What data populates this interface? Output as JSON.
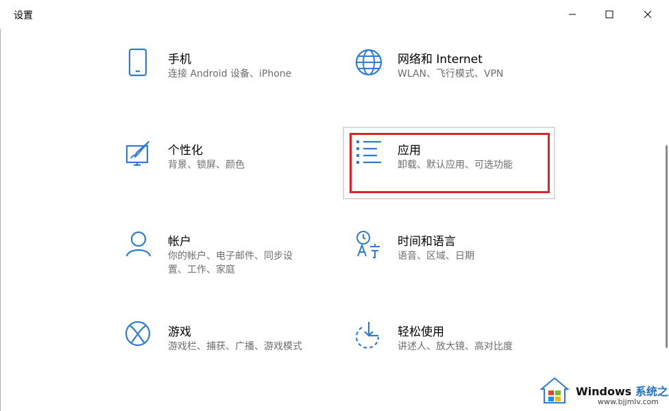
{
  "window": {
    "title": "设置",
    "controls": [
      "minimize",
      "maximize",
      "close"
    ]
  },
  "accent_color": "#2b7bd6",
  "highlight_color": "#e02027",
  "categories": [
    {
      "id": "phone",
      "icon": "phone-icon",
      "title": "手机",
      "desc": [
        "连接 Android 设备、iPhone"
      ]
    },
    {
      "id": "network",
      "icon": "globe-icon",
      "title": "网络和 Internet",
      "desc": [
        "WLAN、飞行模式、VPN"
      ]
    },
    {
      "id": "personalization",
      "icon": "paint-icon",
      "title": "个性化",
      "desc": [
        "背景、锁屏、颜色"
      ]
    },
    {
      "id": "apps",
      "icon": "apps-list-icon",
      "title": "应用",
      "desc": [
        "卸载、默认应用、可选功能"
      ],
      "highlighted": true
    },
    {
      "id": "accounts",
      "icon": "person-icon",
      "title": "帐户",
      "desc": [
        "你的帐户、电子邮件、同步设",
        "置、工作、家庭"
      ]
    },
    {
      "id": "time-language",
      "icon": "time-language-icon",
      "title": "时间和语言",
      "desc": [
        "语音、区域、日期"
      ]
    },
    {
      "id": "gaming",
      "icon": "xbox-icon",
      "title": "游戏",
      "desc": [
        "游戏栏、捕获、广播、游戏模式"
      ]
    },
    {
      "id": "ease-of-access",
      "icon": "ease-of-access-icon",
      "title": "轻松使用",
      "desc": [
        "讲述人、放大镜、高对比度"
      ]
    }
  ],
  "watermark": {
    "title": "Windows",
    "title_cn": "系统之家",
    "url": "www.bjjmlv.com"
  }
}
